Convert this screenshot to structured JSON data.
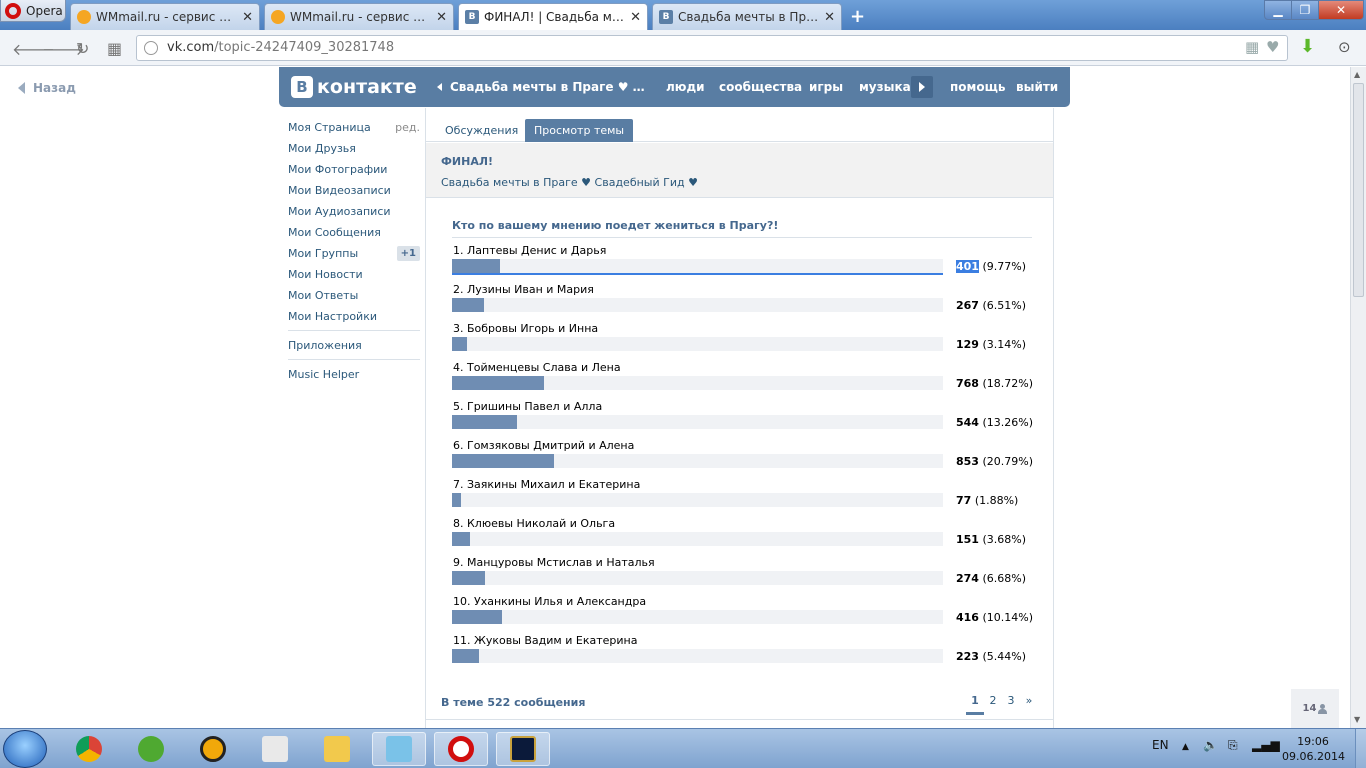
{
  "browser": {
    "menu_label": "Opera",
    "tabs": [
      {
        "title": "WMmail.ru - сервис почтовых",
        "active": false
      },
      {
        "title": "WMmail.ru - сервис почтовых",
        "active": false
      },
      {
        "title": "ФИНАЛ! | Свадьба мечты в Праге",
        "active": true
      },
      {
        "title": "Свадьба мечты в Праге ♥ Свадебный Гид",
        "active": false
      }
    ],
    "url_host": "vk.com",
    "url_path": "/topic-24247409_30281748"
  },
  "page": {
    "back_label": "Назад",
    "vk": {
      "logo_text": "контакте",
      "logo_letter": "В",
      "nav": {
        "crumb": "Свадьба мечты в Праге ♥ Свадебный Гид ♥",
        "people": "люди",
        "communities": "сообщества",
        "games": "игры",
        "music": "музыка",
        "help": "помощь",
        "logout": "выйти"
      }
    },
    "left_menu": {
      "items": [
        {
          "label": "Моя Страница",
          "extra": "ред."
        },
        {
          "label": "Мои Друзья"
        },
        {
          "label": "Мои Фотографии"
        },
        {
          "label": "Мои Видеозаписи"
        },
        {
          "label": "Мои Аудиозаписи"
        },
        {
          "label": "Мои Сообщения"
        },
        {
          "label": "Мои Группы",
          "badge": "+1"
        },
        {
          "label": "Мои Новости"
        },
        {
          "label": "Мои Ответы"
        },
        {
          "label": "Мои Настройки"
        }
      ],
      "apps": "Приложения",
      "music_helper": "Music Helper"
    },
    "tabs": {
      "discussions": "Обсуждения",
      "view_topic": "Просмотр темы"
    },
    "topic": {
      "title": "ФИНАЛ!",
      "group": "Свадьба мечты в Праге ♥ Свадебный Гид ♥"
    },
    "poll": {
      "question": "Кто по вашему мнению поедет жениться в Прагу?!",
      "options": [
        {
          "label": "1. Лаптевы Денис и Дарья",
          "votes": "401",
          "percent": "(9.77%)",
          "share": 9.77
        },
        {
          "label": "2. Лузины Иван и Мария",
          "votes": "267",
          "percent": "(6.51%)",
          "share": 6.51
        },
        {
          "label": "3. Бобровы Игорь и Инна",
          "votes": "129",
          "percent": "(3.14%)",
          "share": 3.14
        },
        {
          "label": "4. Тойменцевы Слава и Лена",
          "votes": "768",
          "percent": "(18.72%)",
          "share": 18.72
        },
        {
          "label": "5. Гришины Павел и Алла",
          "votes": "544",
          "percent": "(13.26%)",
          "share": 13.26
        },
        {
          "label": "6. Гомзяковы Дмитрий и Алена",
          "votes": "853",
          "percent": "(20.79%)",
          "share": 20.79
        },
        {
          "label": "7. Заякины Михаил и Екатерина",
          "votes": "77",
          "percent": "(1.88%)",
          "share": 1.88
        },
        {
          "label": "8. Клюевы Николай и Ольга",
          "votes": "151",
          "percent": "(3.68%)",
          "share": 3.68
        },
        {
          "label": "9. Манцуровы Мстислав и Наталья",
          "votes": "274",
          "percent": "(6.68%)",
          "share": 6.68
        },
        {
          "label": "10. Уханкины Илья и Александра",
          "votes": "416",
          "percent": "(10.14%)",
          "share": 10.14
        },
        {
          "label": "11. Жуковы Вадим и Екатерина",
          "votes": "223",
          "percent": "(5.44%)",
          "share": 5.44
        }
      ]
    },
    "thread_info": "В теме 522 сообщения",
    "pager": [
      "1",
      "2",
      "3",
      "»"
    ],
    "side_badge": "14"
  },
  "taskbar": {
    "lang": "EN",
    "time": "19:06",
    "date": "09.06.2014"
  }
}
